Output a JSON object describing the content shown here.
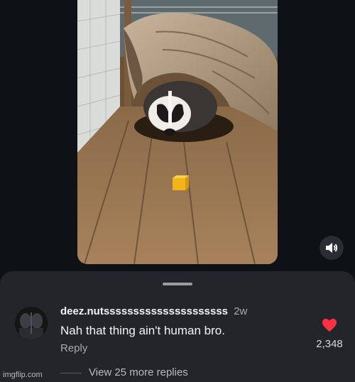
{
  "video": {
    "subject": "badger under log with cheese cube",
    "icons": {
      "mute": "speaker-icon"
    }
  },
  "comment": {
    "username": "deez.nutsssssssssssssssssssss",
    "time": "2w",
    "text": "Nah that thing ain't human bro.",
    "reply_label": "Reply",
    "likes": "2,348",
    "like_icon": "heart-icon",
    "like_color": "#ff3040"
  },
  "replies": {
    "view_label": "View 25 more replies"
  },
  "watermark": "imgflip.com",
  "colors": {
    "background": "#0e1116",
    "sheet": "#23252b",
    "accent": "#ff3040"
  }
}
